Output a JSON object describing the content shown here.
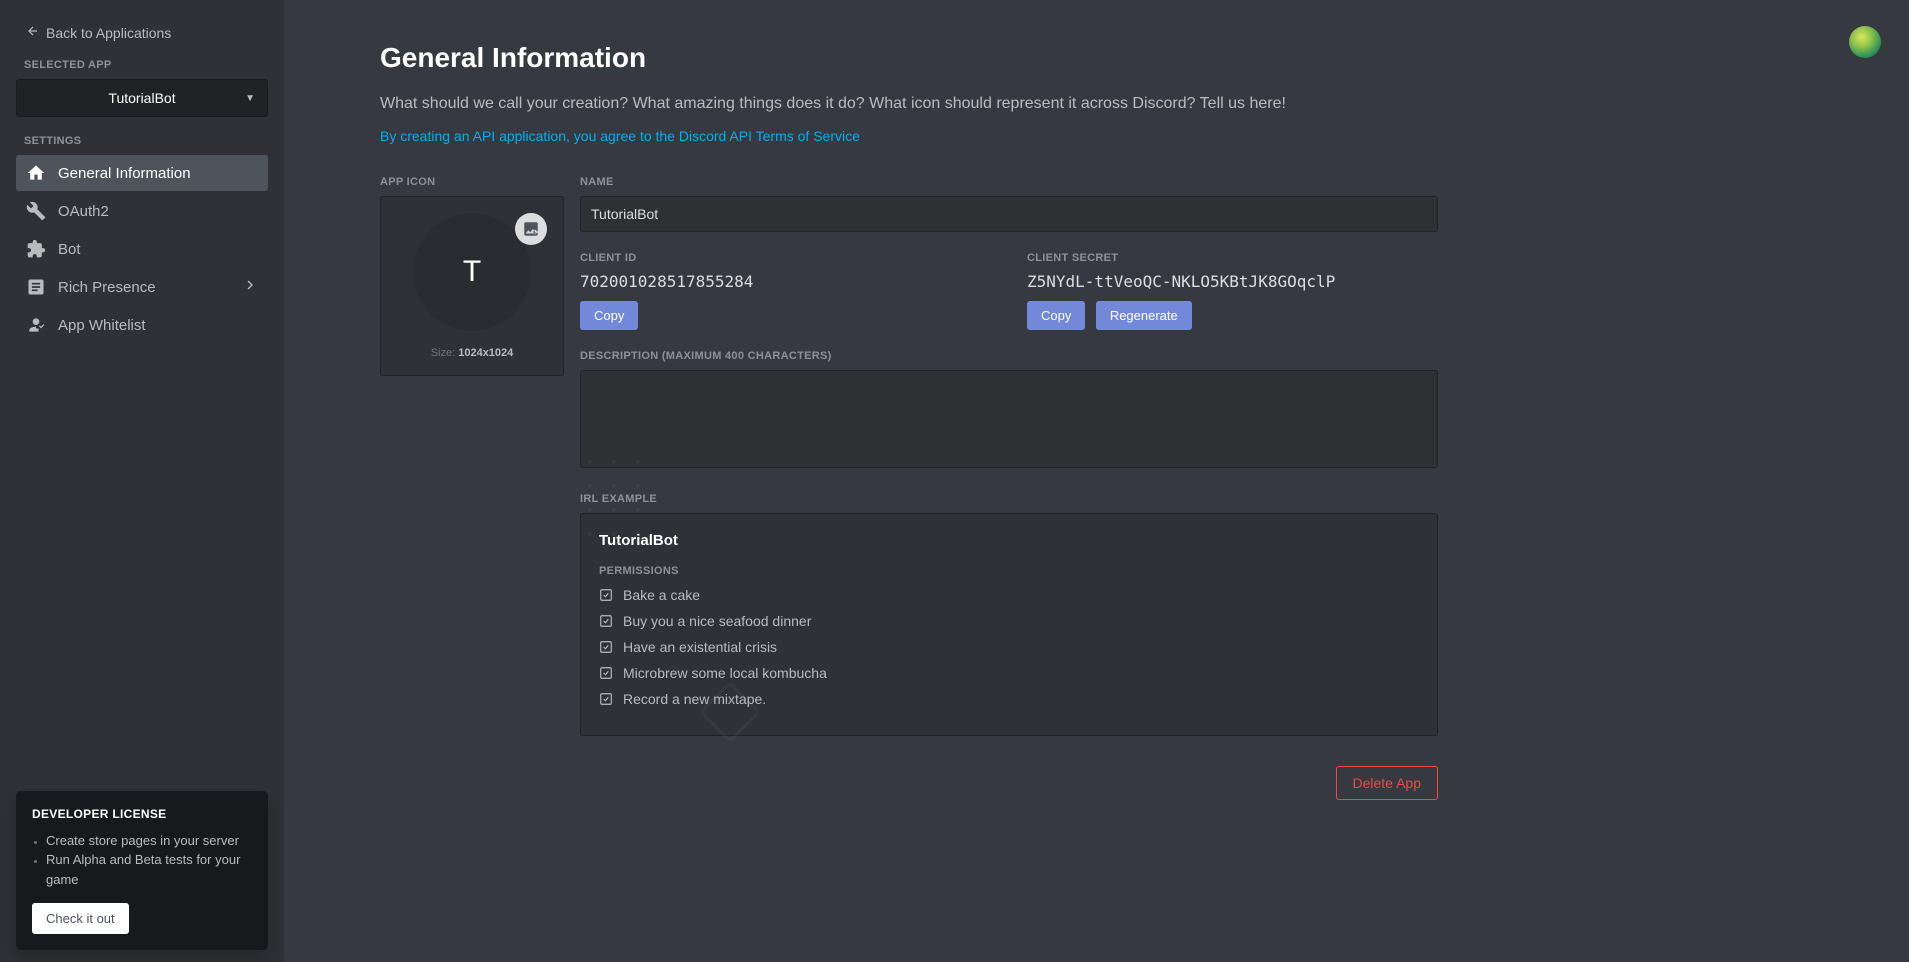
{
  "sidebar": {
    "back_label": "Back to Applications",
    "selected_app_label": "SELECTED APP",
    "selected_app": "TutorialBot",
    "settings_label": "SETTINGS",
    "nav": {
      "general": "General Information",
      "oauth2": "OAuth2",
      "bot": "Bot",
      "rich_presence": "Rich Presence",
      "app_whitelist": "App Whitelist"
    },
    "promo": {
      "title": "DEVELOPER LICENSE",
      "bullet1": "Create store pages in your server",
      "bullet2": "Run Alpha and Beta tests for your game",
      "cta": "Check it out"
    }
  },
  "main": {
    "heading": "General Information",
    "subtitle": "What should we call your creation? What amazing things does it do? What icon should represent it across Discord? Tell us here!",
    "tos": "By creating an API application, you agree to the Discord API Terms of Service",
    "app_icon_label": "APP ICON",
    "icon_letter": "T",
    "size_hint_prefix": "Size: ",
    "size_hint_value": "1024x1024",
    "name_label": "NAME",
    "name_value": "TutorialBot",
    "client_id_label": "CLIENT ID",
    "client_id_value": "702001028517855284",
    "client_secret_label": "CLIENT SECRET",
    "client_secret_value": "Z5NYdL-ttVeoQC-NKLO5KBtJK8GOqclP",
    "copy_label": "Copy",
    "regenerate_label": "Regenerate",
    "description_label": "DESCRIPTION (MAXIMUM 400 CHARACTERS)",
    "description_value": "",
    "irl_label": "IRL EXAMPLE",
    "irl_title": "TutorialBot",
    "permissions_label": "PERMISSIONS",
    "perms": {
      "p1": "Bake a cake",
      "p2": "Buy you a nice seafood dinner",
      "p3": "Have an existential crisis",
      "p4": "Microbrew some local kombucha",
      "p5": "Record a new mixtape."
    },
    "delete_label": "Delete App"
  }
}
